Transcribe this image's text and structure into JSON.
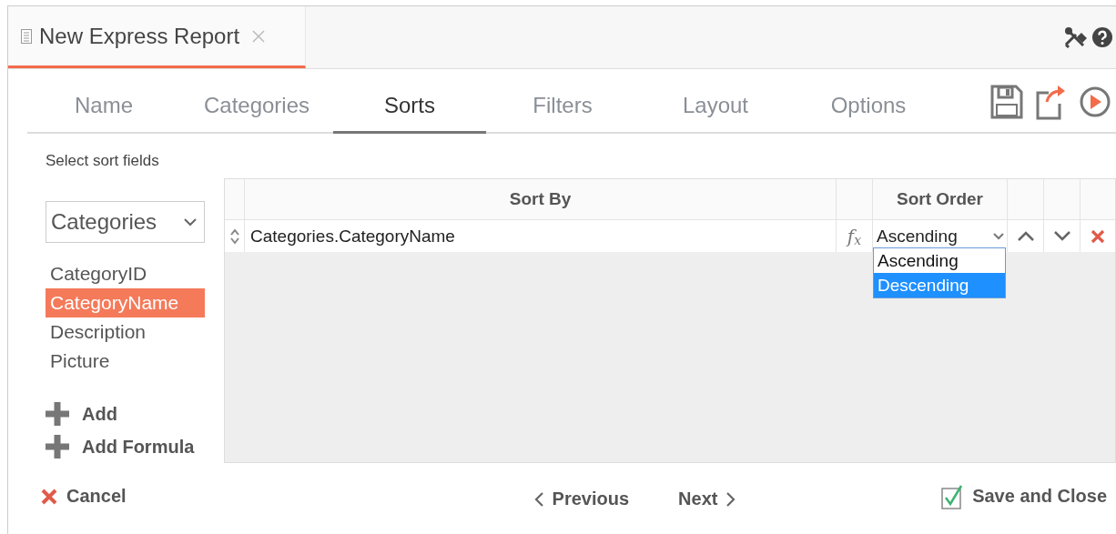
{
  "document_tab": {
    "title": "New Express Report",
    "selected": true
  },
  "wizard_tabs": [
    {
      "label": "Name",
      "selected": false
    },
    {
      "label": "Categories",
      "selected": false
    },
    {
      "label": "Sorts",
      "selected": true
    },
    {
      "label": "Filters",
      "selected": false
    },
    {
      "label": "Layout",
      "selected": false
    },
    {
      "label": "Options",
      "selected": false
    }
  ],
  "sort_fields": {
    "heading": "Select sort fields",
    "table_select": {
      "value": "Categories"
    },
    "fields": [
      {
        "label": "CategoryID",
        "selected": false
      },
      {
        "label": "CategoryName",
        "selected": true
      },
      {
        "label": "Description",
        "selected": false
      },
      {
        "label": "Picture",
        "selected": false
      }
    ],
    "actions": [
      {
        "label": "Add"
      },
      {
        "label": "Add Formula"
      }
    ]
  },
  "sort_grid": {
    "sort_by_header": "Sort By",
    "sort_order_header": "Sort Order",
    "rows": [
      {
        "sort_by": "Categories.CategoryName",
        "formula_button": "f$_{x}$",
        "sort_order": "Ascending"
      }
    ],
    "order_dropdown": {
      "options": [
        {
          "label": "Ascending",
          "selected": false
        },
        {
          "label": "Descending",
          "selected": true
        }
      ]
    }
  },
  "footer": {
    "cancel": "Cancel",
    "previous": "Previous",
    "next": "Next",
    "save": "Save and Close"
  }
}
